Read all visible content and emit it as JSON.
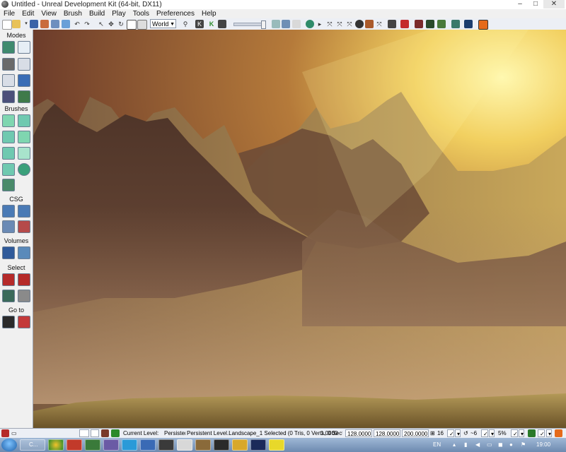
{
  "window": {
    "title": "Untitled - Unreal Development Kit (64-bit, DX11)",
    "minimize": "–",
    "maximize": "□",
    "close": "✕"
  },
  "menu": [
    "File",
    "Edit",
    "View",
    "Brush",
    "Build",
    "Play",
    "Tools",
    "Preferences",
    "Help"
  ],
  "toolbar": {
    "coord_system": "World",
    "icons": [
      "new-icon",
      "open-icon",
      "save-icon",
      "save-all-icon",
      "undo-icon",
      "redo-icon",
      "select-icon",
      "translate-icon",
      "rotate-icon",
      "scale-icon",
      "scale-nonuniform-icon",
      "find-icon",
      "kismet-icon",
      "content-browser-icon",
      "grid-snap-icon",
      "build-icon",
      "lighting-icon",
      "paths-icon",
      "play-icon",
      "console-icon",
      "match-icon"
    ]
  },
  "sidebar": {
    "sections": {
      "modes": "Modes",
      "brushes": "Brushes",
      "csg": "CSG",
      "volumes": "Volumes",
      "select": "Select",
      "goto": "Go to"
    }
  },
  "status": {
    "current_level_label": "Current Level:",
    "current_level_value": "Persistent Le",
    "selection": "Persistent Level.Landscape_1 Selected (0 Tris, 0 Verts, 0 Sect",
    "drag_grid": "1.0000",
    "x": "128.0000",
    "y": "128.0000",
    "z": "200.0000",
    "grid_size": "16",
    "rot_snap": "~6",
    "scale_snap": "5%"
  },
  "taskbar": {
    "active_app": "C...",
    "lang": "EN",
    "time": "19:00"
  },
  "colors": {
    "sky_glow": "#fff6a0",
    "sky_top": "#8a4a30",
    "mountain": "#5a3c2e",
    "ground": "#a38a4a"
  }
}
